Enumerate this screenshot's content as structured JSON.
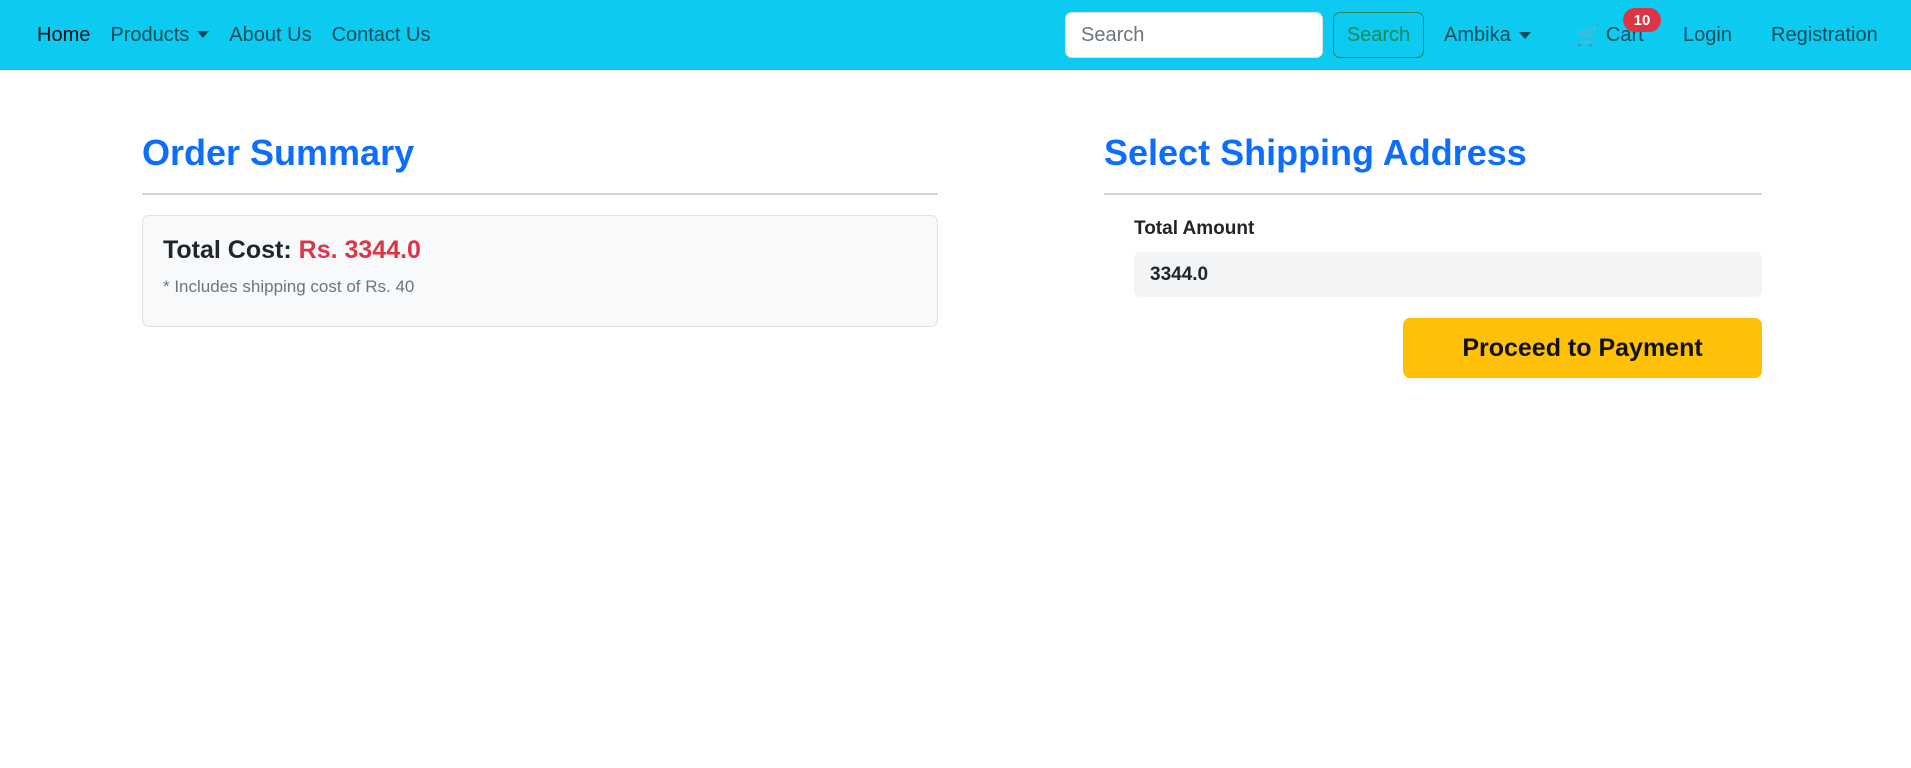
{
  "navbar": {
    "links": [
      "Home",
      "Products",
      "About Us",
      "Contact Us"
    ],
    "search": {
      "placeholder": "Search",
      "button_label": "Search"
    },
    "user_menu_label": "Ambika",
    "cart": {
      "label": "Cart",
      "count": "10"
    },
    "login_label": "Login",
    "registration_label": "Registration"
  },
  "order_summary": {
    "heading": "Order Summary",
    "total_cost_label": "Total Cost:",
    "total_cost_value": "Rs. 3344.0",
    "shipping_note": "* Includes shipping cost of Rs. 40"
  },
  "shipping": {
    "heading": "Select Shipping Address",
    "total_amount_label": "Total Amount",
    "total_amount_value": "3344.0",
    "proceed_button_label": "Proceed to Payment"
  },
  "colors": {
    "navbar_bg": "#0dcaf0",
    "heading_blue": "#0d6efd",
    "price_red": "#dc3545",
    "search_green": "#198754",
    "button_yellow": "#ffc107"
  },
  "icons": {
    "cart": "shopping-cart-icon",
    "dropdown": "chevron-down-icon"
  }
}
